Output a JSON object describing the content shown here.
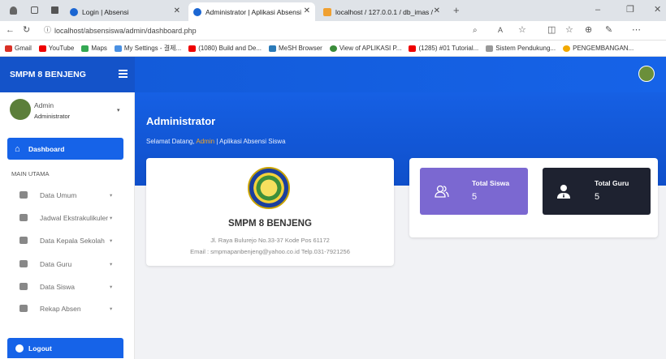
{
  "browser": {
    "tabs": [
      {
        "label": "Login | Absensi"
      },
      {
        "label": "Administrator | Aplikasi Absensi"
      },
      {
        "label": "localhost / 127.0.0.1 / db_imas /"
      }
    ],
    "url": "localhost/absensiswa/admin/dashboard.php",
    "bookmarks": [
      "Gmail",
      "YouTube",
      "Maps",
      "My Settings - 결제...",
      "(1080) Build and De...",
      "MeSH Browser",
      "View of APLIKASI P...",
      "(1285) #01 Tutorial...",
      "Sistem Pendukung...",
      "PENGEMBANGAN..."
    ]
  },
  "app": {
    "brand": "SMPM 8 BENJENG",
    "user": {
      "name": "Admin",
      "role": "Administrator"
    },
    "dashboard_label": "Dashboard",
    "section_title": "MAIN UTAMA",
    "menu": [
      {
        "label": "Data Umum"
      },
      {
        "label": "Jadwal Ekstrakulikuler"
      },
      {
        "label": "Data Kepala Sekolah"
      },
      {
        "label": "Data Guru"
      },
      {
        "label": "Data Siswa"
      },
      {
        "label": "Rekap Absen"
      }
    ],
    "logout_label": "Logout"
  },
  "page": {
    "title": "Administrator",
    "welcome_prefix": "Selamat Datang,",
    "welcome_name": "Admin",
    "welcome_suffix": "| Aplikasi Absensi Siswa"
  },
  "school": {
    "name": "SMPM 8 BENJENG",
    "address": "Jl. Raya Bulurejo No.33-37 Kode Pos 61172",
    "contact": "Email : smpmapanbenjeng@yahoo.co.id Telp.031-7921256"
  },
  "stats": [
    {
      "label": "Total Siswa",
      "value": "5",
      "color": "#7b68d1"
    },
    {
      "label": "Total Guru",
      "value": "5",
      "color": "#1e2230"
    }
  ]
}
